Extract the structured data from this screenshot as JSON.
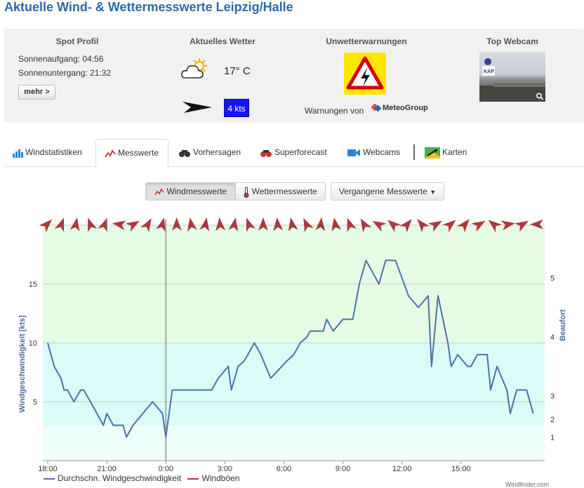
{
  "page": {
    "title": "Aktuelle Wind- & Wettermesswerte Leipzig/Halle"
  },
  "info": {
    "spot_profile": {
      "heading": "Spot Profil",
      "sunrise": "Sonnenaufgang: 04:56",
      "sunset": "Sonnenuntergang: 21:32",
      "more_button": "mehr >"
    },
    "weather": {
      "heading": "Aktuelles Wetter",
      "weather_icon": "partly-cloudy-icon",
      "temperature": "17° C",
      "wind_direction_icon": "wind-arrow-icon",
      "wind_speed": "4 kts"
    },
    "warnings": {
      "heading": "Unwetterwarnungen",
      "warning_icon": "lightning-warning-icon",
      "provided_by": "Warnungen von",
      "provider": "MeteoGroup"
    },
    "webcam": {
      "heading": "Top Webcam",
      "zoom_icon": "magnifier-icon"
    }
  },
  "tabs": [
    {
      "label": "Windstatistiken",
      "icon": "bar-chart-icon"
    },
    {
      "label": "Messwerte",
      "icon": "line-chart-icon",
      "active": true
    },
    {
      "label": "Vorhersagen",
      "icon": "binoculars-icon"
    },
    {
      "label": "Superforecast",
      "icon": "binoculars-red-icon"
    },
    {
      "label": "Webcams",
      "icon": "camera-icon"
    },
    {
      "label": "Karten",
      "icon": "map-icon"
    }
  ],
  "controls": {
    "wind_button": "Windmesswerte",
    "weather_button": "Wettermesswerte",
    "past_dropdown": "Vergangene Messwerte"
  },
  "chart_data": {
    "type": "line",
    "ylabel": "Windgeschwindigkeit [kts]",
    "y2label": "Beaufort",
    "y_ticks": [
      5,
      10,
      15
    ],
    "y_range": [
      0,
      20
    ],
    "beaufort_ticks": [
      {
        "label": "1",
        "kts": 2
      },
      {
        "label": "2",
        "kts": 3.5
      },
      {
        "label": "3",
        "kts": 5.5
      },
      {
        "label": "4",
        "kts": 10.5
      },
      {
        "label": "5",
        "kts": 15.5
      }
    ],
    "x_range_hours": [
      -0.25,
      17.5
    ],
    "x_ticks": [
      "18:00",
      "21:00",
      "0:00",
      "3:00",
      "6:00",
      "9:00",
      "12:00",
      "15:00"
    ],
    "x_tick_hours": [
      0,
      3,
      6,
      9,
      12,
      15,
      18,
      21
    ],
    "series": [
      {
        "name": "Durchschn. Windgeschwindigkeit",
        "color": "#4a74a8",
        "points": [
          [
            0,
            10
          ],
          [
            0.33,
            8
          ],
          [
            0.67,
            7
          ],
          [
            0.83,
            6
          ],
          [
            1,
            6
          ],
          [
            1.33,
            5
          ],
          [
            1.67,
            6
          ],
          [
            1.83,
            6
          ],
          [
            2.17,
            5
          ],
          [
            2.5,
            4
          ],
          [
            2.83,
            3
          ],
          [
            3,
            4
          ],
          [
            3.33,
            3
          ],
          [
            3.83,
            3
          ],
          [
            4,
            2
          ],
          [
            4.33,
            3
          ],
          [
            5.33,
            5
          ],
          [
            5.83,
            4
          ],
          [
            6,
            2
          ],
          [
            6.33,
            6
          ],
          [
            7.33,
            6
          ],
          [
            8.33,
            6
          ],
          [
            8.67,
            7
          ],
          [
            9.17,
            8
          ],
          [
            9.33,
            6
          ],
          [
            9.67,
            8
          ],
          [
            10,
            8.5
          ],
          [
            10.5,
            10
          ],
          [
            10.83,
            9
          ],
          [
            11.33,
            7
          ],
          [
            12.17,
            8.5
          ],
          [
            12.5,
            9
          ],
          [
            12.83,
            10
          ],
          [
            13.17,
            10.5
          ],
          [
            13.33,
            11
          ],
          [
            13.67,
            11
          ],
          [
            14,
            11
          ],
          [
            14.17,
            12
          ],
          [
            14.5,
            11
          ],
          [
            15,
            12
          ],
          [
            15.5,
            12
          ],
          [
            15.83,
            15
          ],
          [
            16.17,
            17
          ],
          [
            16.5,
            16
          ],
          [
            16.83,
            15
          ],
          [
            17.17,
            17
          ],
          [
            17.67,
            17
          ],
          [
            18.33,
            14
          ],
          [
            18.83,
            13
          ],
          [
            19.33,
            14
          ],
          [
            19.5,
            8
          ],
          [
            19.83,
            14
          ],
          [
            20.33,
            10
          ],
          [
            20.5,
            8
          ],
          [
            20.83,
            9
          ],
          [
            21.33,
            8
          ],
          [
            21.5,
            8
          ],
          [
            21.83,
            9
          ],
          [
            22.33,
            9
          ],
          [
            22.5,
            6
          ],
          [
            22.83,
            8
          ],
          [
            23.33,
            6
          ],
          [
            23.5,
            4
          ],
          [
            23.83,
            6
          ],
          [
            24.33,
            6
          ],
          [
            24.67,
            4
          ]
        ]
      },
      {
        "name": "Windböen",
        "color": "#a83a3a",
        "points": []
      }
    ],
    "bands": [
      {
        "from": 0,
        "to": 3,
        "color": "#effdfb"
      },
      {
        "from": 3,
        "to": 10,
        "color": "#dafbf8"
      },
      {
        "from": 10,
        "to": 20,
        "color": "#e6fbe4"
      }
    ],
    "direction_arrow_angles": [
      45,
      20,
      10,
      -20,
      20,
      -80,
      60,
      30,
      15,
      0,
      -10,
      10,
      -5,
      10,
      -20,
      0,
      -5,
      -10,
      -25,
      5,
      -10,
      -20,
      -30,
      -60,
      -50,
      40,
      -40,
      60,
      50,
      40,
      60,
      -50,
      80,
      60,
      -90
    ],
    "legend": [
      "Durchschn. Windgeschwindigkeit",
      "Windböen"
    ]
  },
  "footer": {
    "credit": "Windfinder.com"
  },
  "colors": {
    "title": "#2a6aa8",
    "accent_badge": "#1515ff",
    "warning": "#ffe600"
  }
}
